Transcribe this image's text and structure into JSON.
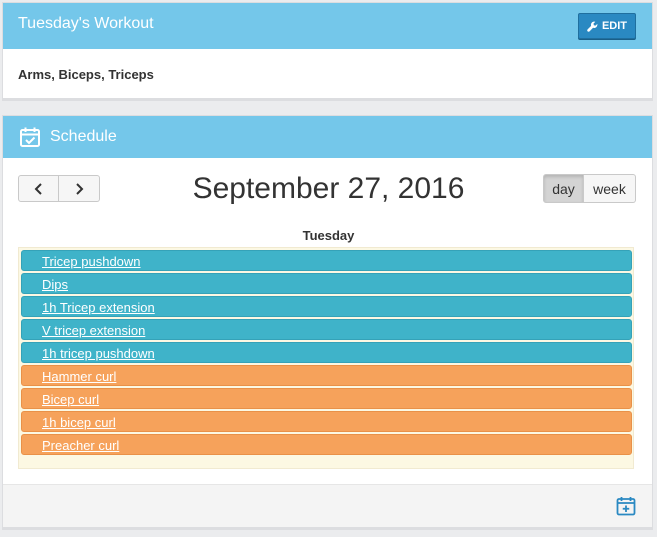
{
  "workout": {
    "title": "Tuesday's Workout",
    "edit_label": "EDIT",
    "subtitle": "Arms, Biceps, Triceps"
  },
  "schedule": {
    "title": "Schedule",
    "date": "September 27, 2016",
    "day_label": "day",
    "week_label": "week",
    "active_view": "day",
    "day_header": "Tuesday",
    "events": [
      {
        "label": "Tricep pushdown",
        "color": "#3fb3c9"
      },
      {
        "label": "Dips",
        "color": "#3fb3c9"
      },
      {
        "label": "1h Tricep extension",
        "color": "#3fb3c9"
      },
      {
        "label": "V tricep extension",
        "color": "#3fb3c9"
      },
      {
        "label": "1h tricep pushdown",
        "color": "#3fb3c9"
      },
      {
        "label": "Hammer curl",
        "color": "#f6a25b"
      },
      {
        "label": "Bicep curl",
        "color": "#f6a25b"
      },
      {
        "label": "1h bicep curl",
        "color": "#f6a25b"
      },
      {
        "label": "Preacher curl",
        "color": "#f6a25b"
      }
    ]
  },
  "icons": {
    "edit": "wrench-icon",
    "schedule": "calendar-check-icon",
    "prev": "chevron-left-icon",
    "next": "chevron-right-icon",
    "add": "calendar-plus-icon"
  },
  "colors": {
    "header_bg": "#74c7ea",
    "edit_button": "#2a89c2",
    "event_tricep": "#3fb3c9",
    "event_bicep": "#f6a25b",
    "day_bg": "#fcf8e3"
  }
}
